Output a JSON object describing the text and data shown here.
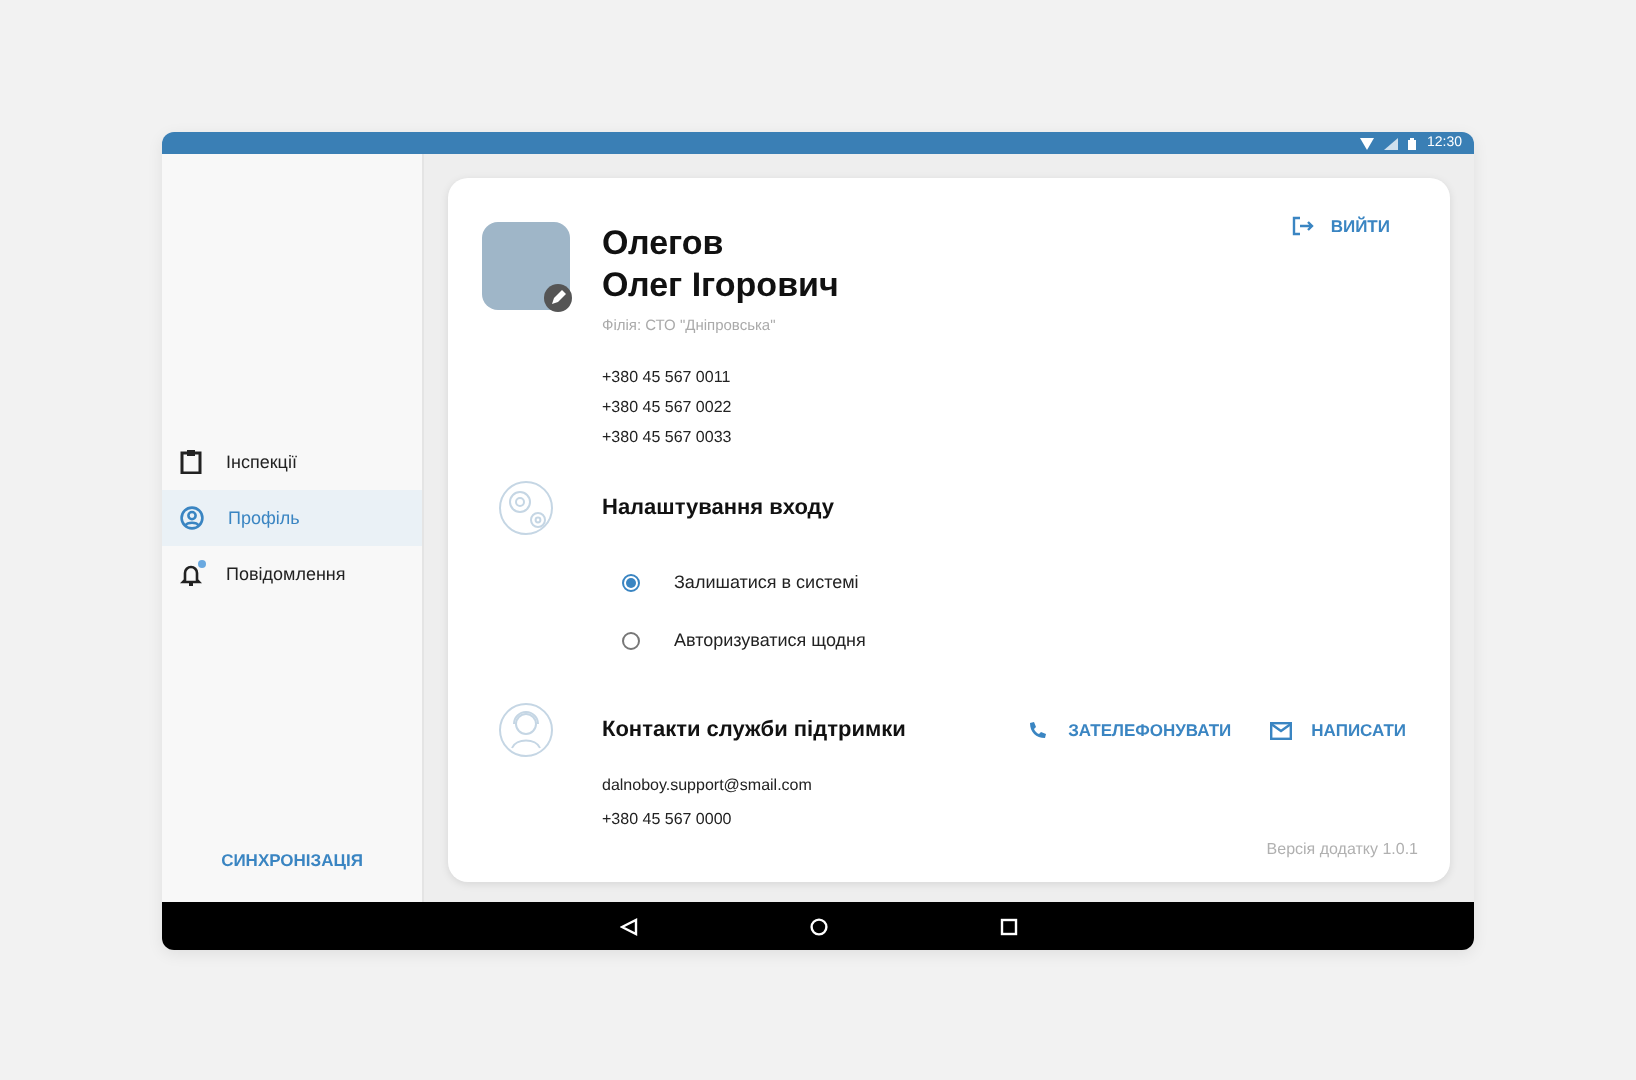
{
  "status_bar": {
    "time": "12:30"
  },
  "sidebar": {
    "items": [
      {
        "label": "Інспекції",
        "selected": false,
        "badge": false
      },
      {
        "label": "Профіль",
        "selected": true,
        "badge": false
      },
      {
        "label": "Повідомлення",
        "selected": false,
        "badge": true
      }
    ],
    "sync_button": "СИНХРОНІЗАЦІЯ"
  },
  "profile": {
    "surname": "Олегов",
    "name": "Олег Ігорович",
    "branch": "Філія: СТО \"Дніпровська\"",
    "phones": [
      "+380 45 567 0011",
      "+380 45 567 0022",
      "+380 45 567 0033"
    ],
    "logout_button": "ВИЙТИ"
  },
  "login_settings": {
    "title": "Налаштування входу",
    "options": [
      {
        "label": "Залишатися в системі",
        "selected": true
      },
      {
        "label": "Авторизуватися щодня",
        "selected": false
      }
    ]
  },
  "support": {
    "title": "Контакти служби підтримки",
    "call_button": "ЗАТЕЛЕФОНУВАТИ",
    "write_button": "НАПИСАТИ",
    "email": "dalnoboy.support@smail.com",
    "phone": "+380 45 567 0000"
  },
  "version": "Версія додатку 1.0.1"
}
